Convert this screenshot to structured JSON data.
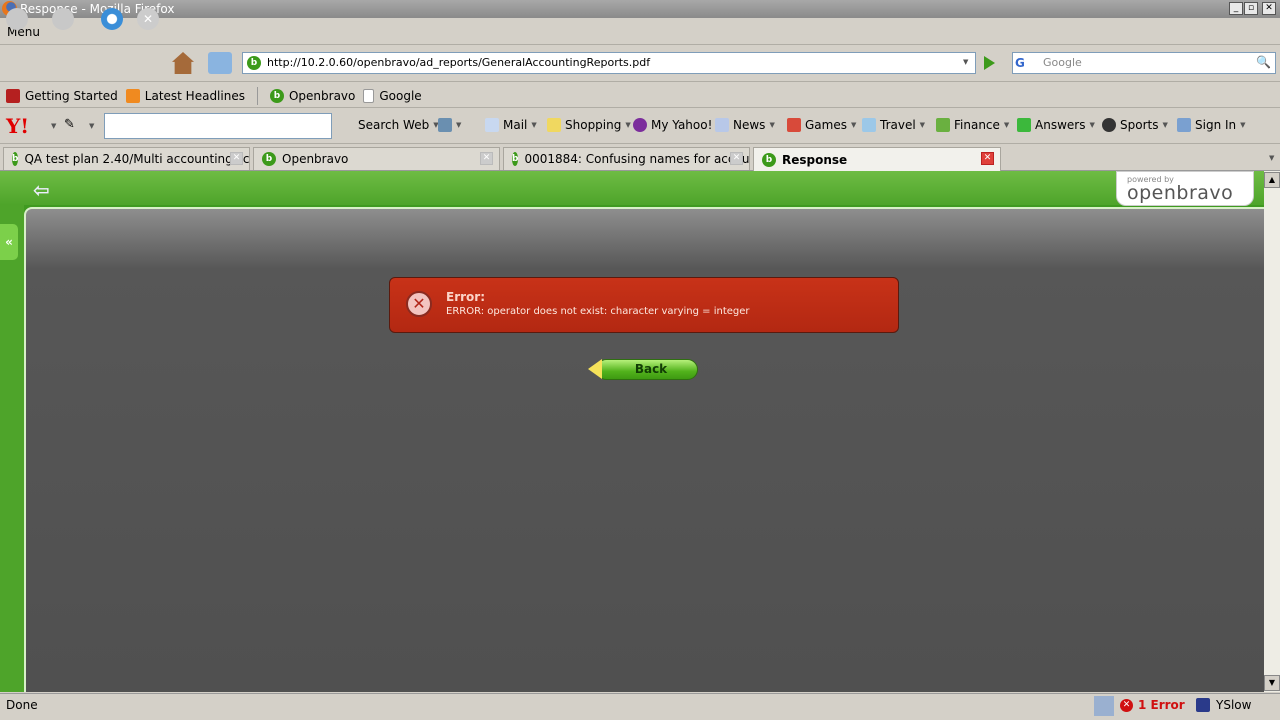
{
  "window": {
    "title": "Response - Mozilla Firefox",
    "min": "_",
    "max": "▫",
    "close": "✕"
  },
  "menu": {
    "label": "Menu"
  },
  "nav": {
    "url": "http://10.2.0.60/openbravo/ad_reports/GeneralAccountingReports.pdf",
    "search_placeholder": "Google"
  },
  "bookmarks": [
    "Getting Started",
    "Latest Headlines",
    "Openbravo",
    "Google"
  ],
  "yahoo": {
    "search_web": "Search Web",
    "items": [
      "Mail",
      "Shopping",
      "My Yahoo!",
      "News",
      "Games",
      "Travel",
      "Finance",
      "Answers",
      "Sports",
      "Sign In"
    ]
  },
  "tabs": [
    {
      "label": "QA test plan 2.40/Multi accounting sc..."
    },
    {
      "label": "Openbravo"
    },
    {
      "label": "0001884: Confusing names for accou..."
    },
    {
      "label": "Response"
    }
  ],
  "page": {
    "logo_small": "powered by",
    "logo": "openbravo",
    "error_title": "Error:",
    "error_message": "ERROR: operator does not exist: character varying = integer",
    "back": "Back"
  },
  "status": {
    "text": "Done",
    "errors": "1 Error",
    "yslow": "YSlow"
  },
  "colors": {
    "error_bg": "#c0301a",
    "green": "#4ea42a",
    "content_bg": "#505050"
  }
}
